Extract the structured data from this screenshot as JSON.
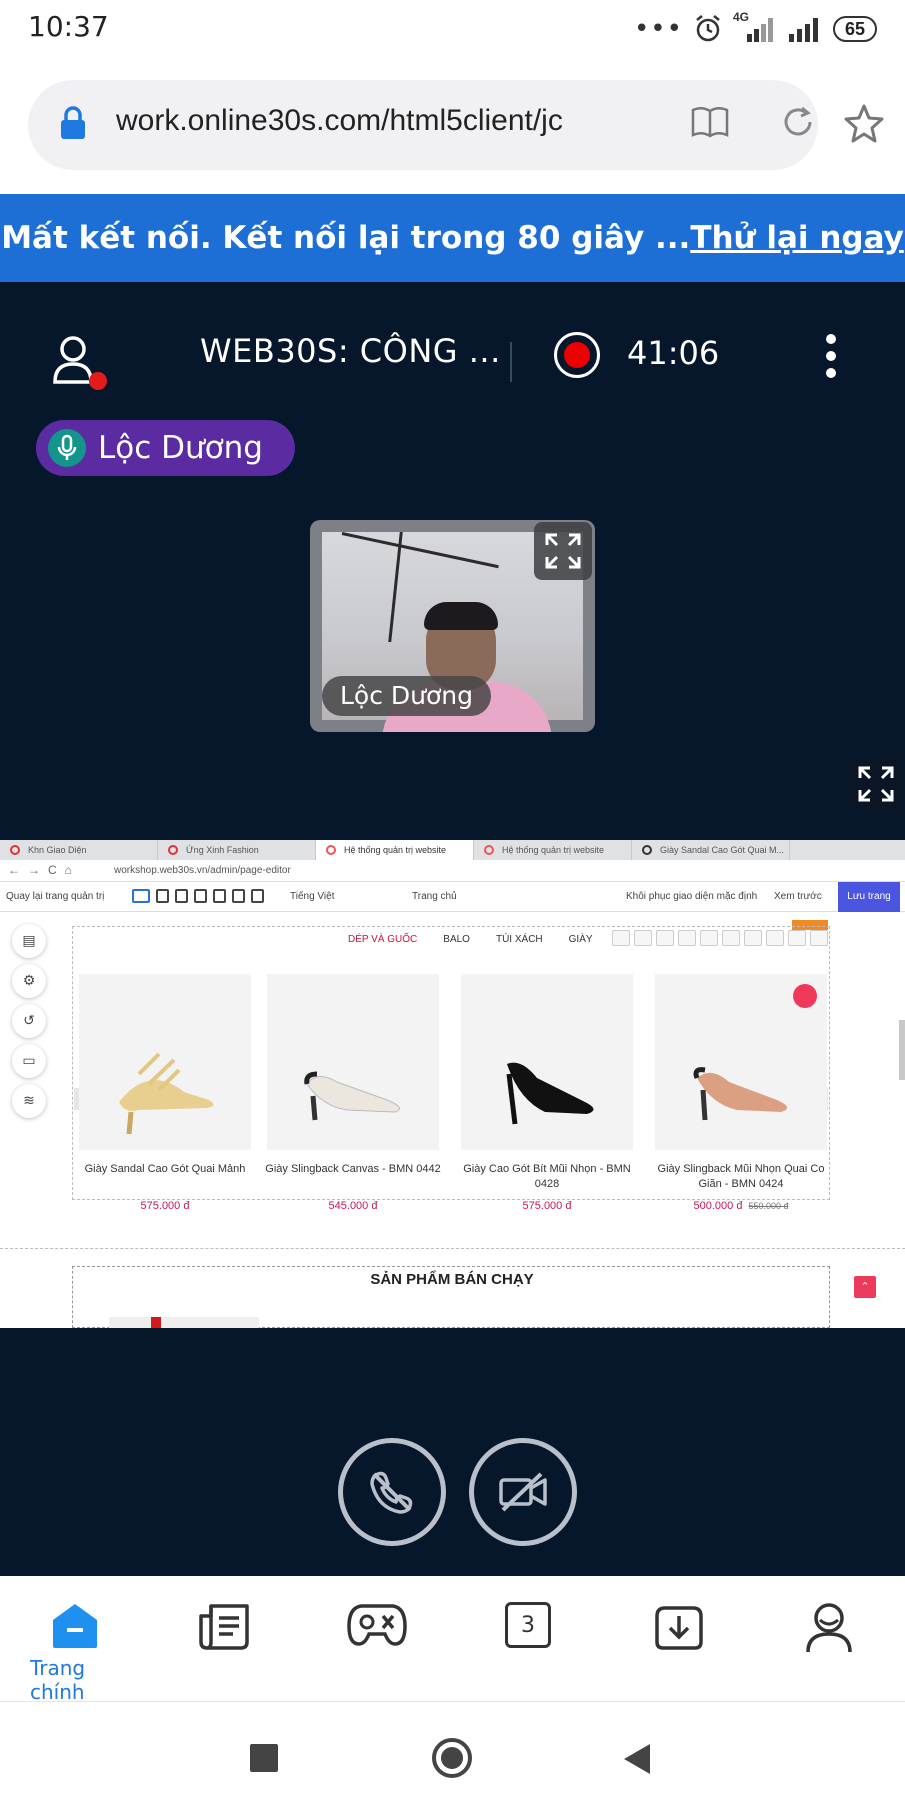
{
  "status_bar": {
    "time": "10:37",
    "network": "4G",
    "battery": "65",
    "icons": [
      "more-dots-icon",
      "alarm-icon",
      "signal-icon",
      "signal-icon-2",
      "battery-icon"
    ]
  },
  "browser": {
    "url": "work.online30s.com/html5client/jc",
    "icons": [
      "lock-icon",
      "reader-mode-icon",
      "reload-icon",
      "bookmark-star-icon"
    ]
  },
  "banner": {
    "message": "Mất kết nối. Kết nối lại trong 80 giây ...",
    "retry_link": "Thử lại ngay"
  },
  "meeting": {
    "title": "WEB30S: CÔNG ...",
    "timer": "41:06",
    "current_speaker": "Lộc Dương",
    "video_tile_name": "Lộc Dương"
  },
  "shared_screen": {
    "tabs": [
      "Khn Giao Diện",
      "Ứng Xinh Fashion",
      "Hệ thống quản trị website",
      "Hệ thống quản trị website",
      "Giày Sandal Cao Gót Quai M..."
    ],
    "address": "workshop.web30s.vn/admin/page-editor",
    "toolbar": {
      "back": "Quay lại trang quản trị",
      "language": "Tiếng Việt",
      "page": "Trang chủ",
      "restore": "Khôi phục giao diện mặc định",
      "preview": "Xem trước",
      "save": "Lưu trang"
    },
    "menu": [
      "DÉP VÀ GUỐC",
      "BALO",
      "TÚI XÁCH",
      "GIÀY"
    ],
    "products": [
      {
        "name": "Giày Sandal Cao Gót Quai Mảnh",
        "price": "575.000 đ",
        "old_price": ""
      },
      {
        "name": "Giày Slingback Canvas - BMN 0442",
        "price": "545.000 đ",
        "old_price": ""
      },
      {
        "name": "Giày Cao Gót Bít Mũi Nhọn - BMN 0428",
        "price": "575.000 đ",
        "old_price": ""
      },
      {
        "name": "Giày Slingback Mũi Nhọn Quai Co Giãn - BMN 0424",
        "price": "500.000 đ",
        "old_price": "550.000 đ"
      }
    ],
    "section_title": "SẢN PHẨM BÁN CHẠY"
  },
  "bottom_nav": {
    "home_label": "Trang chính",
    "tab_count": "3"
  },
  "colors": {
    "banner": "#1d6fd6",
    "meeting_bg": "#06172c",
    "speaker_pill": "#5b2ba1",
    "accent": "#1e7ae0"
  }
}
